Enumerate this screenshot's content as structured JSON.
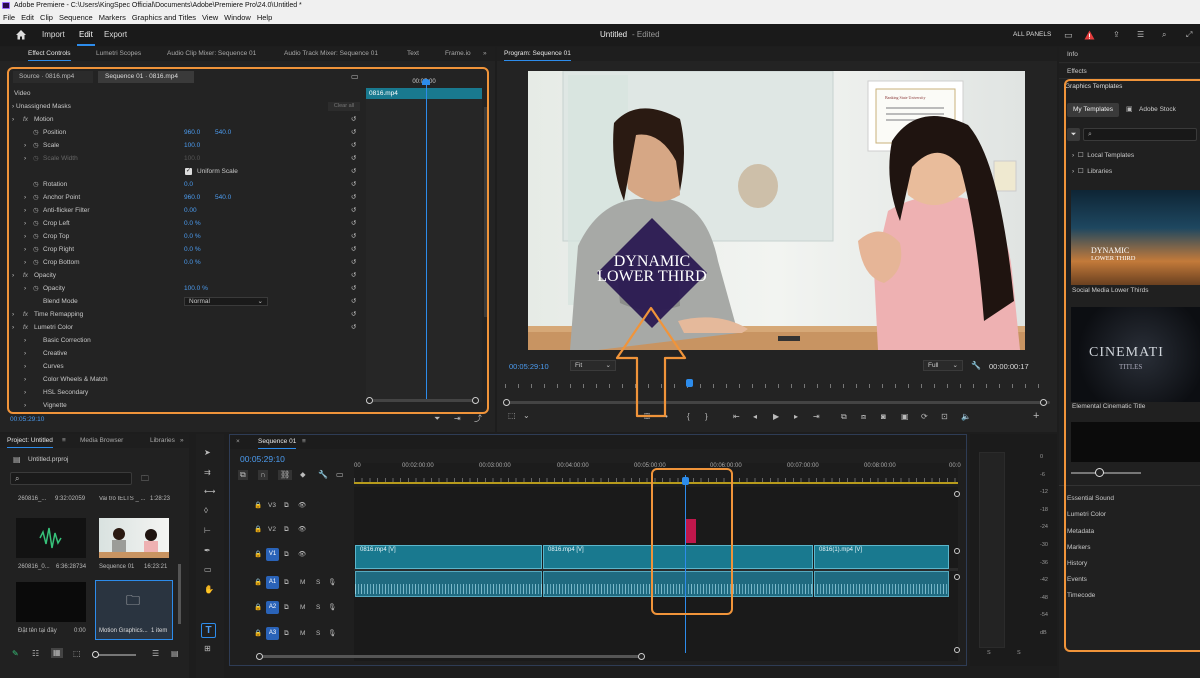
{
  "app": {
    "window_title": "Adobe Premiere - C:\\Users\\KingSpec Official\\Documents\\Adobe\\Premiere Pro\\24.0\\Untitled *"
  },
  "menu": [
    "File",
    "Edit",
    "Clip",
    "Sequence",
    "Markers",
    "Graphics and Titles",
    "View",
    "Window",
    "Help"
  ],
  "header": {
    "workspaces": [
      "Import",
      "Edit",
      "Export"
    ],
    "project_title": "Untitled",
    "edited": "- Edited",
    "all_panels": "ALL PANELS"
  },
  "effect_panel": {
    "tabs": [
      "Effect Controls",
      "Lumetri Scopes",
      "Audio Clip Mixer: Sequence 01",
      "Audio Track Mixer: Sequence 01",
      "Text",
      "Frame.io"
    ],
    "source_tab": "Source · 0816.mp4",
    "sequence_tab": "Sequence 01 · 0816.mp4",
    "timecode_top": "00:05:00",
    "clip_label": "0816.mp4",
    "video_label": "Video",
    "masks_label": "Unassigned Masks",
    "clear_all": "Clear all",
    "rows": [
      {
        "label": "Motion",
        "fx": true
      },
      {
        "label": "Position",
        "v1": "960.0",
        "v2": "540.0"
      },
      {
        "label": "Scale",
        "v1": "100.0"
      },
      {
        "label": "Scale Width",
        "v1": "100.0",
        "dim": true
      },
      {
        "label": "Uniform Scale",
        "check": true
      },
      {
        "label": "Rotation",
        "v1": "0.0"
      },
      {
        "label": "Anchor Point",
        "v1": "960.0",
        "v2": "540.0"
      },
      {
        "label": "Anti-flicker Filter",
        "v1": "0.00"
      },
      {
        "label": "Crop Left",
        "v1": "0.0 %"
      },
      {
        "label": "Crop Top",
        "v1": "0.0 %"
      },
      {
        "label": "Crop Right",
        "v1": "0.0 %"
      },
      {
        "label": "Crop Bottom",
        "v1": "0.0 %"
      },
      {
        "label": "Opacity",
        "fx": true
      },
      {
        "label": "Opacity",
        "v1": "100.0 %"
      },
      {
        "label": "Blend Mode",
        "select": "Normal"
      },
      {
        "label": "Time Remapping",
        "fx": true
      },
      {
        "label": "Lumetri Color",
        "fx": true
      },
      {
        "label": "Basic Correction"
      },
      {
        "label": "Creative"
      },
      {
        "label": "Curves"
      },
      {
        "label": "Color Wheels & Match"
      },
      {
        "label": "HSL Secondary"
      },
      {
        "label": "Vignette"
      }
    ],
    "timecode_bottom": "00:05:29:10"
  },
  "program": {
    "tab": "Program: Sequence 01",
    "overlay_line1": "DYNAMIC",
    "overlay_line2": "LOWER THIRD",
    "sign_text": "Banking State University",
    "timecode": "00:05:29:10",
    "fit": "Fit",
    "quality": "Full",
    "duration": "00:00:00:17",
    "playhead_fraction": 0.34
  },
  "project": {
    "tabs": [
      "Project: Untitled",
      "Media Browser",
      "Libraries"
    ],
    "file": "Untitled.prproj",
    "items": [
      {
        "name": "260816_...",
        "dur": "9:32:02059"
      },
      {
        "name": "Vai trò IELTS _ ...",
        "dur": "1:28:23"
      },
      {
        "name": "260816_0...",
        "dur": "6:36:28734"
      },
      {
        "name": "Sequence 01",
        "dur": "16:23:21"
      },
      {
        "name": "Đặt tên tại đây",
        "dur": "0:00"
      },
      {
        "name": "Motion Graphics...",
        "dur": "1 item"
      }
    ]
  },
  "timeline": {
    "tab": "Sequence 01",
    "timecode": "00:05:29:10",
    "ticks": [
      "00",
      "00:02:00:00",
      "00:03:00:00",
      "00:04:00:00",
      "00:05:00:00",
      "00:06:00:00",
      "00:07:00:00",
      "00:08:00:00",
      "00:0"
    ],
    "tracks": [
      "V3",
      "V2",
      "V1",
      "A1",
      "A2",
      "A3"
    ],
    "clips": [
      "0816.mp4 [V]",
      "0816.mp4 [V]",
      "0816(1).mp4 [V]"
    ],
    "track_letters": {
      "m": "M",
      "s": "S"
    }
  },
  "meters": {
    "labels": [
      "0",
      "-6",
      "-12",
      "-18",
      "-24",
      "-30",
      "-36",
      "-42",
      "-48",
      "-54",
      "dB"
    ],
    "solo": [
      "S",
      "S"
    ]
  },
  "right_panel": {
    "info": "Info",
    "effects": "Effects",
    "graphics_templates": "Graphics Templates",
    "my_templates": "My Templates",
    "adobe_stock": "Adobe Stock",
    "local_templates": "Local Templates",
    "libraries": "Libraries",
    "templates": [
      {
        "name": "Social Media Lower Thirds",
        "t1": "DYNAMIC",
        "t2": "LOWER THIRD"
      },
      {
        "name": "Elemental Cinematic Title",
        "t1": "CINEMATI",
        "t2": "TITLES"
      }
    ],
    "bottom": [
      "Essential Sound",
      "Lumetri Color",
      "Metadata",
      "Markers",
      "History",
      "Events",
      "Timecode"
    ]
  },
  "colors": {
    "accent": "#2d8ceb",
    "highlight": "#f0943a",
    "clip": "#19798f",
    "dark": "#232323"
  }
}
